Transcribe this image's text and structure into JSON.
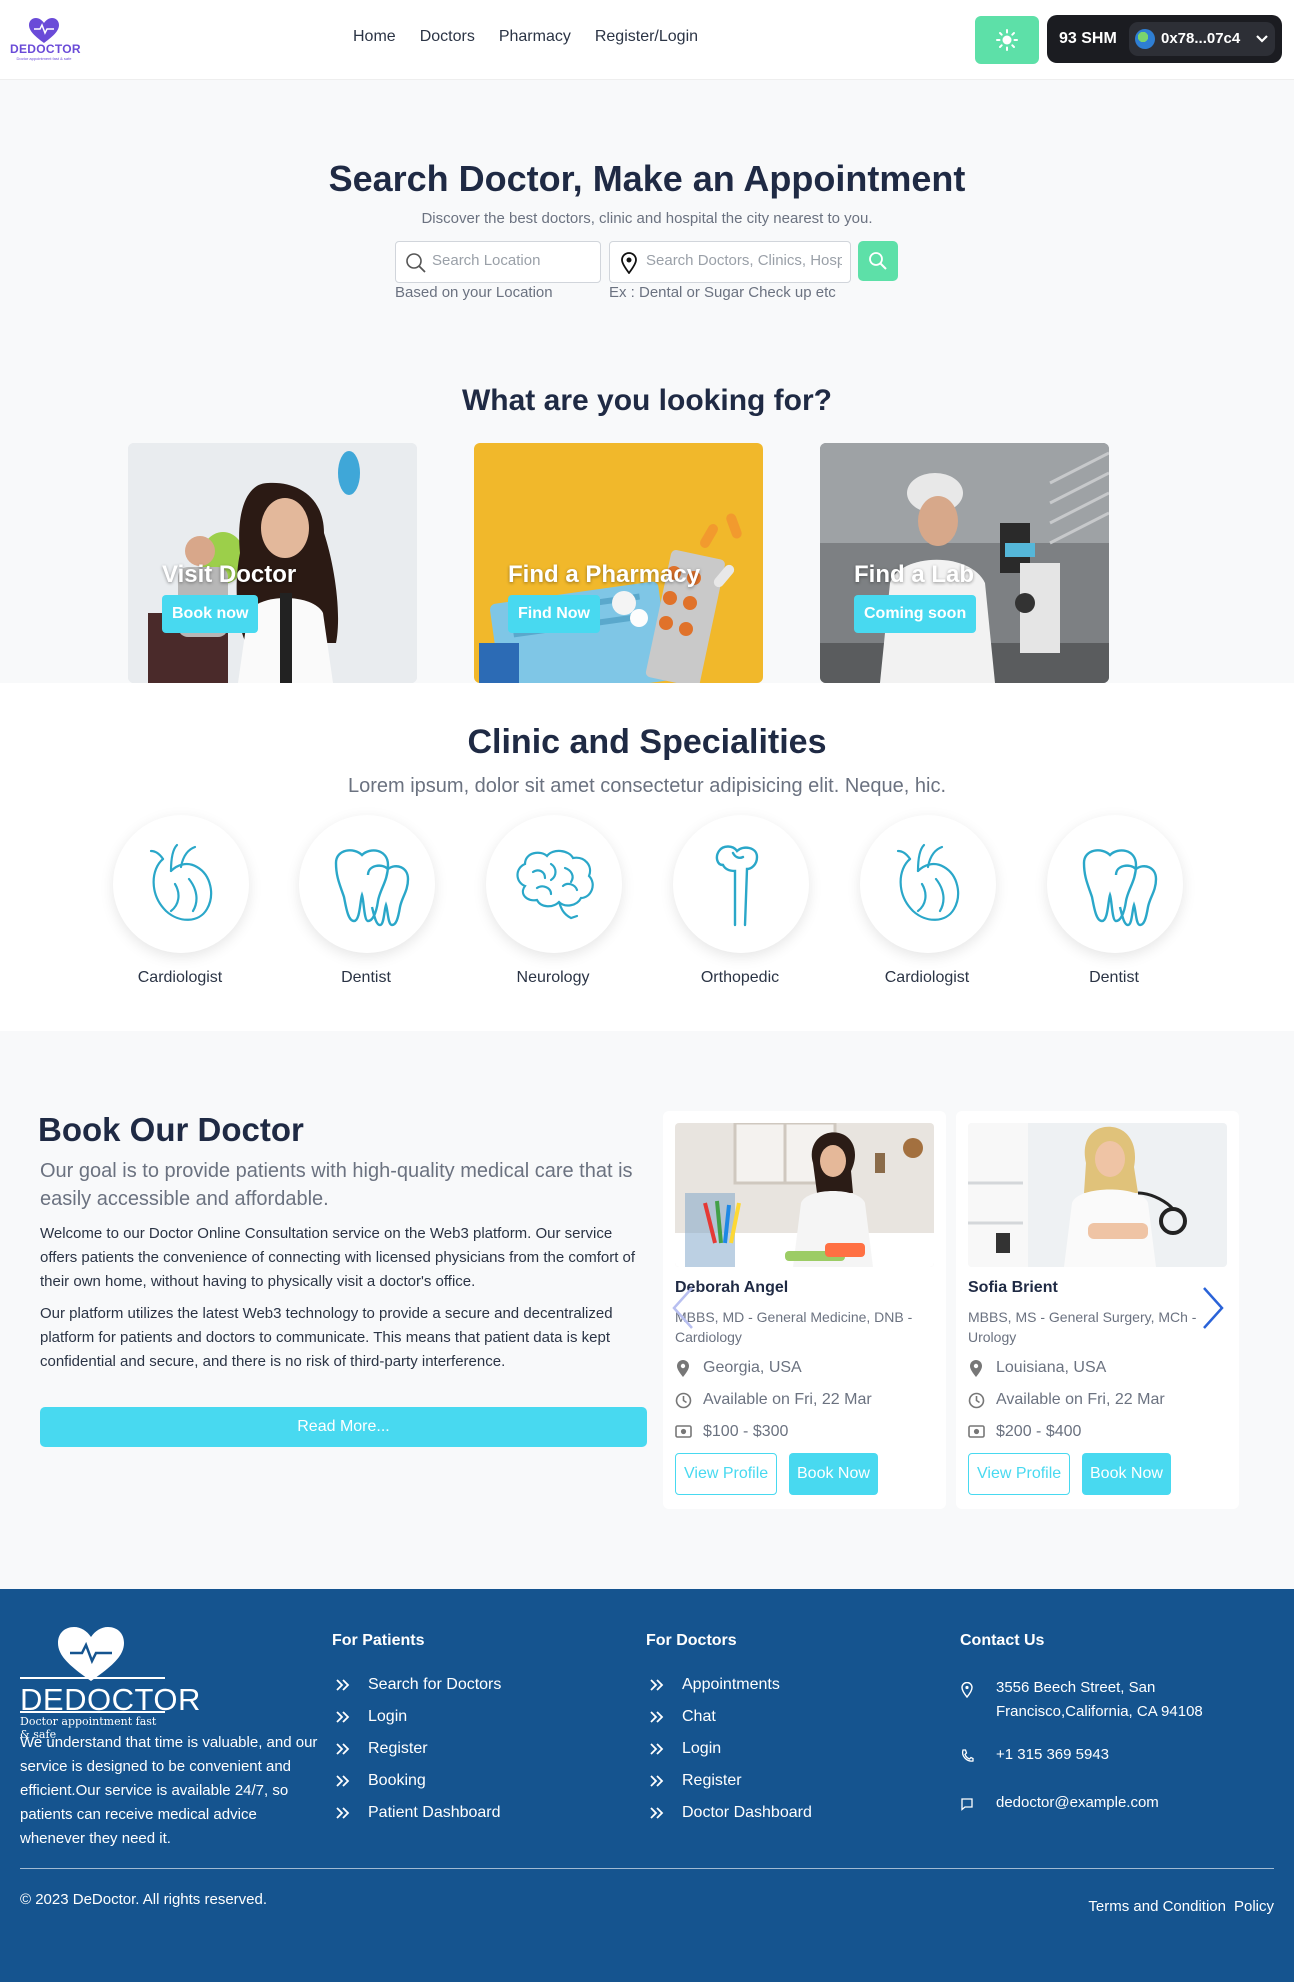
{
  "header": {
    "logo_name": "DEDOCTOR",
    "logo_tagline": "Doctor appointment fast & safe",
    "nav": [
      "Home",
      "Doctors",
      "Pharmacy",
      "Register/Login"
    ],
    "wallet_balance": "93 SHM",
    "wallet_address": "0x78...07c4"
  },
  "hero": {
    "title": "Search Doctor, Make an Appointment",
    "subtitle": "Discover the best doctors, clinic and hospital the city nearest to you.",
    "location_placeholder": "Search Location",
    "location_hint": "Based on your Location",
    "doctor_placeholder": "Search Doctors, Clinics, Hospitals, Diseases Etc",
    "doctor_hint": "Ex : Dental or Sugar Check up etc"
  },
  "looking": {
    "title": "What are you looking for?",
    "cards": [
      {
        "title": "Visit Doctor",
        "button": "Book now"
      },
      {
        "title": "Find a Pharmacy",
        "button": "Find Now"
      },
      {
        "title": "Find a Lab",
        "button": "Coming soon"
      }
    ]
  },
  "specialities": {
    "title": "Clinic and Specialities",
    "subtitle": "Lorem ipsum, dolor sit amet consectetur adipisicing elit. Neque, hic.",
    "items": [
      {
        "label": "Cardiologist",
        "icon": "heart-organ-icon"
      },
      {
        "label": "Dentist",
        "icon": "tooth-icon"
      },
      {
        "label": "Neurology",
        "icon": "brain-icon"
      },
      {
        "label": "Orthopedic",
        "icon": "bone-icon"
      },
      {
        "label": "Cardiologist",
        "icon": "heart-organ-icon"
      },
      {
        "label": "Dentist",
        "icon": "tooth-icon"
      }
    ]
  },
  "book": {
    "title": "Book Our Doctor",
    "lead": "Our goal is to provide patients with high-quality medical care that is easily accessible and affordable.",
    "p1": "Welcome to our Doctor Online Consultation service on the Web3 platform. Our service offers patients the convenience of connecting with licensed physicians from the comfort of their own home, without having to physically visit a doctor's office.",
    "p2": "Our platform utilizes the latest Web3 technology to provide a secure and decentralized platform for patients and doctors to communicate. This means that patient data is kept confidential and secure, and there is no risk of third-party interference.",
    "read_more": "Read More...",
    "doctors": [
      {
        "name": "Deborah Angel",
        "qualification": "MBBS, MD - General Medicine, DNB - Cardiology",
        "location": "Georgia, USA",
        "availability": "Available on Fri, 22 Mar",
        "price": "$100 - $300",
        "view": "View Profile",
        "book": "Book Now"
      },
      {
        "name": "Sofia Brient",
        "qualification": "MBBS, MS - General Surgery, MCh - Urology",
        "location": "Louisiana, USA",
        "availability": "Available on Fri, 22 Mar",
        "price": "$200 - $400",
        "view": "View Profile",
        "book": "Book Now"
      }
    ]
  },
  "footer": {
    "logo_name": "DEDOCTOR",
    "logo_tagline": "Doctor appointment fast & safe",
    "about": "We understand that time is valuable, and our service is designed to be convenient and efficient.Our service is available 24/7, so patients can receive medical advice whenever they need it.",
    "patients_title": "For Patients",
    "patients_links": [
      "Search for Doctors",
      "Login",
      "Register",
      "Booking",
      "Patient Dashboard"
    ],
    "doctors_title": "For Doctors",
    "doctors_links": [
      "Appointments",
      "Chat",
      "Login",
      "Register",
      "Doctor Dashboard"
    ],
    "contact_title": "Contact Us",
    "address": "3556 Beech Street, San Francisco,California, CA 94108",
    "phone": "+1 315 369 5943",
    "email": "dedoctor@example.com",
    "copyright": "© 2023 DeDoctor. All rights reserved.",
    "terms": "Terms and Condition",
    "policy": "Policy"
  },
  "colors": {
    "accent": "#48d9f0",
    "green": "#5de0a8",
    "footer": "#15548f",
    "brand": "#6a4bd8"
  }
}
